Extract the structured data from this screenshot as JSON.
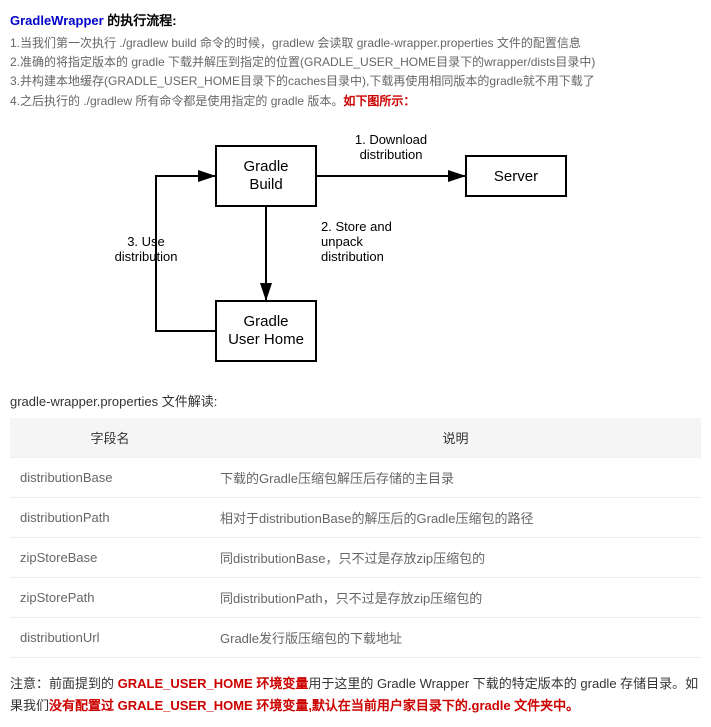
{
  "title_prefix": "GradleWrapper",
  "title_suffix": " 的执行流程:",
  "steps": {
    "s1": "1.当我们第一次执行 ./gradlew build 命令的时候，gradlew 会读取 gradle-wrapper.properties 文件的配置信息",
    "s2": "2.准确的将指定版本的 gradle 下载并解压到指定的位置(GRADLE_USER_HOME目录下的wrapper/dists目录中)",
    "s3": "3.并构建本地缓存(GRADLE_USER_HOME目录下的caches目录中),下载再使用相同版本的gradle就不用下载了",
    "s4_a": "4.之后执行的 ./gradlew 所有命令都是使用指定的 gradle 版本。",
    "s4_b": "如下图所示："
  },
  "diagram": {
    "box_gradle_build_l1": "Gradle",
    "box_gradle_build_l2": "Build",
    "box_server": "Server",
    "box_gradle_userhome_l1": "Gradle",
    "box_gradle_userhome_l2": "User Home",
    "label1_l1": "1. Download",
    "label1_l2": "distribution",
    "label2_l1": "2. Store and",
    "label2_l2": "unpack",
    "label2_l3": "distribution",
    "label3_l1": "3. Use",
    "label3_l2": "distribution"
  },
  "table_title": "gradle-wrapper.properties 文件解读:",
  "table": {
    "header_field": "字段名",
    "header_desc": "说明",
    "rows": [
      {
        "field": "distributionBase",
        "desc": "下载的Gradle压缩包解压后存储的主目录"
      },
      {
        "field": "distributionPath",
        "desc": "相对于distributionBase的解压后的Gradle压缩包的路径"
      },
      {
        "field": "zipStoreBase",
        "desc": "同distributionBase，只不过是存放zip压缩包的"
      },
      {
        "field": "zipStorePath",
        "desc": "同distributionPath，只不过是存放zip压缩包的"
      },
      {
        "field": "distributionUrl",
        "desc": "Gradle发行版压缩包的下载地址"
      }
    ]
  },
  "note": {
    "p1": "注意：前面提到的 ",
    "p2": "GRALE_USER_HOME 环境变量",
    "p3": "用于这里的 Gradle Wrapper 下载的特定版本的 gradle 存储目录。如果我们",
    "p4": "没有配置过 GRALE_USER_HOME 环境变量,默认在当前用户家目录下的.gradle 文件夹中。"
  }
}
